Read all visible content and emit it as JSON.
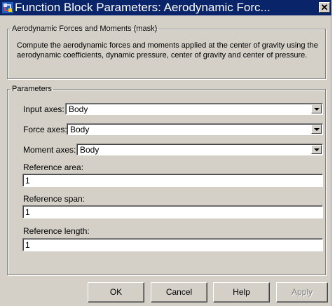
{
  "window": {
    "title": "Function Block Parameters: Aerodynamic Forc...",
    "close_glyph": "✕"
  },
  "mask": {
    "legend": "Aerodynamic Forces and Moments (mask)",
    "description": "Compute the aerodynamic forces and moments applied at the center of gravity using the aerodynamic coefficients, dynamic pressure, center of gravity and center of pressure."
  },
  "parameters": {
    "legend": "Parameters",
    "input_axes": {
      "label": "Input axes:",
      "value": "Body"
    },
    "force_axes": {
      "label": "Force axes:",
      "value": "Body"
    },
    "moment_axes": {
      "label": "Moment axes:",
      "value": "Body"
    },
    "reference_area": {
      "label": "Reference area:",
      "value": "1"
    },
    "reference_span": {
      "label": "Reference span:",
      "value": "1"
    },
    "reference_length": {
      "label": "Reference length:",
      "value": "1"
    }
  },
  "buttons": {
    "ok": "OK",
    "cancel": "Cancel",
    "help": "Help",
    "apply": "Apply"
  },
  "icons": {
    "app": "simulink-block-icon",
    "close": "close-icon",
    "dropdown": "chevron-down-icon"
  }
}
